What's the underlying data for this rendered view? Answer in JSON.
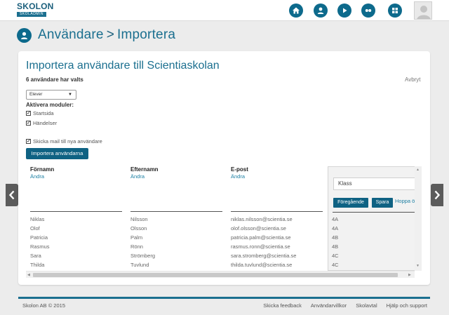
{
  "brand": {
    "logo_word": "SKOLON",
    "logo_tagline": "SKOLADMIN",
    "primary_color": "#0d6a8c",
    "title_color": "#1b6f8f"
  },
  "topnav": {
    "icons": [
      "home-icon",
      "user-icon",
      "play-icon",
      "group-icon",
      "apps-icon"
    ]
  },
  "breadcrumb": {
    "section": "Användare",
    "separator": ">",
    "page": "Importera"
  },
  "card": {
    "title": "Importera användare till Scientiaskolan",
    "selected_count": "6 användare har valts",
    "cancel_label": "Avbryt",
    "role_select": {
      "value": "Elever"
    },
    "modules_label": "Aktivera moduler:",
    "modules": [
      {
        "label": "Startsida",
        "checked": true
      },
      {
        "label": "Händelser",
        "checked": true
      }
    ],
    "send_mail": {
      "label": "Skicka mail till nya användare",
      "checked": true
    },
    "import_button": "Importera användarna"
  },
  "table": {
    "columns": [
      {
        "header": "Förnamn",
        "change": "Ändra"
      },
      {
        "header": "Efternamn",
        "change": "Ändra"
      },
      {
        "header": "E-post",
        "change": "Ändra"
      }
    ],
    "class_panel": {
      "input_value": "Klass",
      "previous_button": "Föregående",
      "save_button": "Spara",
      "skip_link": "Hoppa över"
    },
    "rows": [
      {
        "first": "Niklas",
        "last": "Nilsson",
        "email": "niklas.nilsson@scientia.se",
        "class": "4A"
      },
      {
        "first": "Olof",
        "last": "Olsson",
        "email": "olof.olsson@scientia.se",
        "class": "4A"
      },
      {
        "first": "Patricia",
        "last": "Palm",
        "email": "patricia.palm@scientia.se",
        "class": "4B"
      },
      {
        "first": "Rasmus",
        "last": "Rönn",
        "email": "rasmus.ronn@scientia.se",
        "class": "4B"
      },
      {
        "first": "Sara",
        "last": "Strömberg",
        "email": "sara.stromberg@scientia.se",
        "class": "4C"
      },
      {
        "first": "Thilda",
        "last": "Tuvlund",
        "email": "thilda.tuvlund@scientia.se",
        "class": "4C"
      }
    ]
  },
  "footer": {
    "copyright": "Skolon AB © 2015",
    "links": [
      "Skicka feedback",
      "Användarvillkor",
      "Skolavtal",
      "Hjälp och support"
    ],
    "accent_color": "#1b6f8f"
  }
}
